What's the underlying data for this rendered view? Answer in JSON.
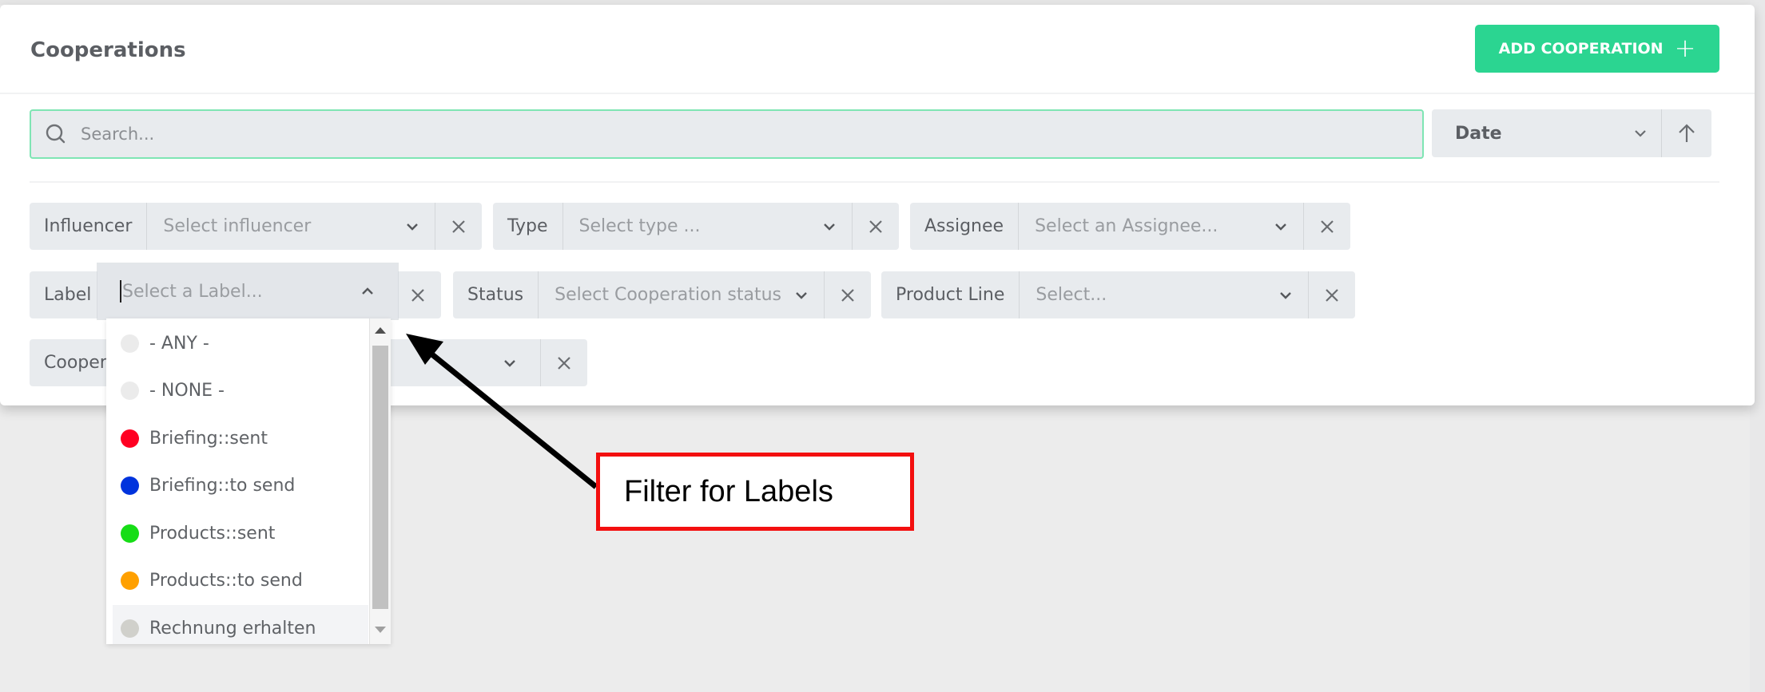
{
  "card": {
    "title": "Cooperations",
    "add_button_label": "ADD COOPERATION",
    "add_button_icon": "plus-icon"
  },
  "search": {
    "placeholder": "Search...",
    "value": "",
    "icon": "search-icon"
  },
  "sort": {
    "selected": "Date",
    "direction_icon": "arrow-up-icon"
  },
  "filters": {
    "influencer": {
      "label": "Influencer",
      "placeholder": "Select influencer"
    },
    "type": {
      "label": "Type",
      "placeholder": "Select type ..."
    },
    "assignee": {
      "label": "Assignee",
      "placeholder": "Select an Assignee..."
    },
    "label": {
      "label": "Label",
      "placeholder": "Select a Label...",
      "open": true
    },
    "status": {
      "label": "Status",
      "placeholder": "Select Cooperation status"
    },
    "product_line": {
      "label": "Product Line",
      "placeholder": "Select..."
    },
    "cooperation": {
      "label": "Cooper"
    }
  },
  "label_options": [
    {
      "text": "- ANY -",
      "color": "#ebebeb"
    },
    {
      "text": "- NONE -",
      "color": "#ebebeb"
    },
    {
      "text": "Briefing::sent",
      "color": "#ff0022"
    },
    {
      "text": "Briefing::to send",
      "color": "#0033dd"
    },
    {
      "text": "Products::sent",
      "color": "#16dd16"
    },
    {
      "text": "Products::to send",
      "color": "#ffa000"
    },
    {
      "text": "Rechnung erhalten",
      "color": "#d0d0cb",
      "hovered": true
    }
  ],
  "annotation": {
    "text": "Filter for Labels",
    "border_color": "#f30f0f"
  },
  "colors": {
    "accent": "#2bd591",
    "search_focus_border": "#7fe5b4",
    "filter_bg": "#e8ebee"
  }
}
